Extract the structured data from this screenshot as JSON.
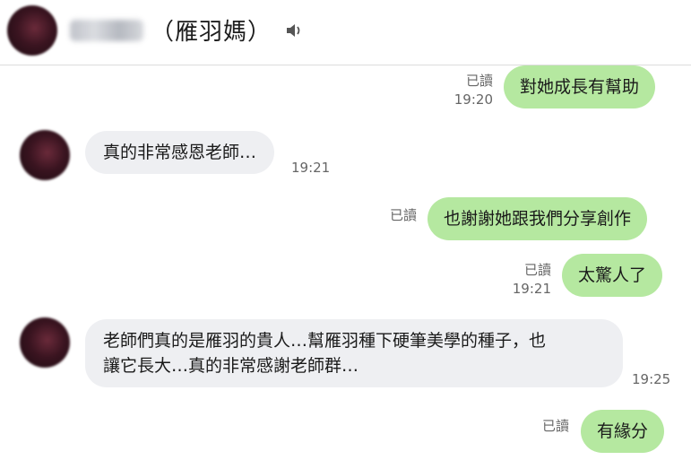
{
  "header": {
    "title": "（雁羽媽）",
    "speaker_icon": "speaker-icon"
  },
  "messages": [
    {
      "side": "out",
      "text": "對她成長有幫助",
      "read": "已讀",
      "time": "19:20"
    },
    {
      "side": "in",
      "text": "真的非常感恩老師…",
      "time": "19:21"
    },
    {
      "side": "out",
      "text": "也謝謝她跟我們分享創作",
      "read": "已讀",
      "time": ""
    },
    {
      "side": "out",
      "text": "太驚人了",
      "read": "已讀",
      "time": "19:21"
    },
    {
      "side": "in",
      "text_line1": "老師們真的是雁羽的貴人…幫雁羽種下硬筆美學的種子，也",
      "text_line2": "讓它長大…真的非常感謝老師群…",
      "time": "19:25"
    },
    {
      "side": "out",
      "text": "有緣分",
      "read": "已讀",
      "time": ""
    }
  ],
  "colors": {
    "outgoing_bubble": "#b5e8a0",
    "incoming_bubble": "#eeeff2"
  }
}
